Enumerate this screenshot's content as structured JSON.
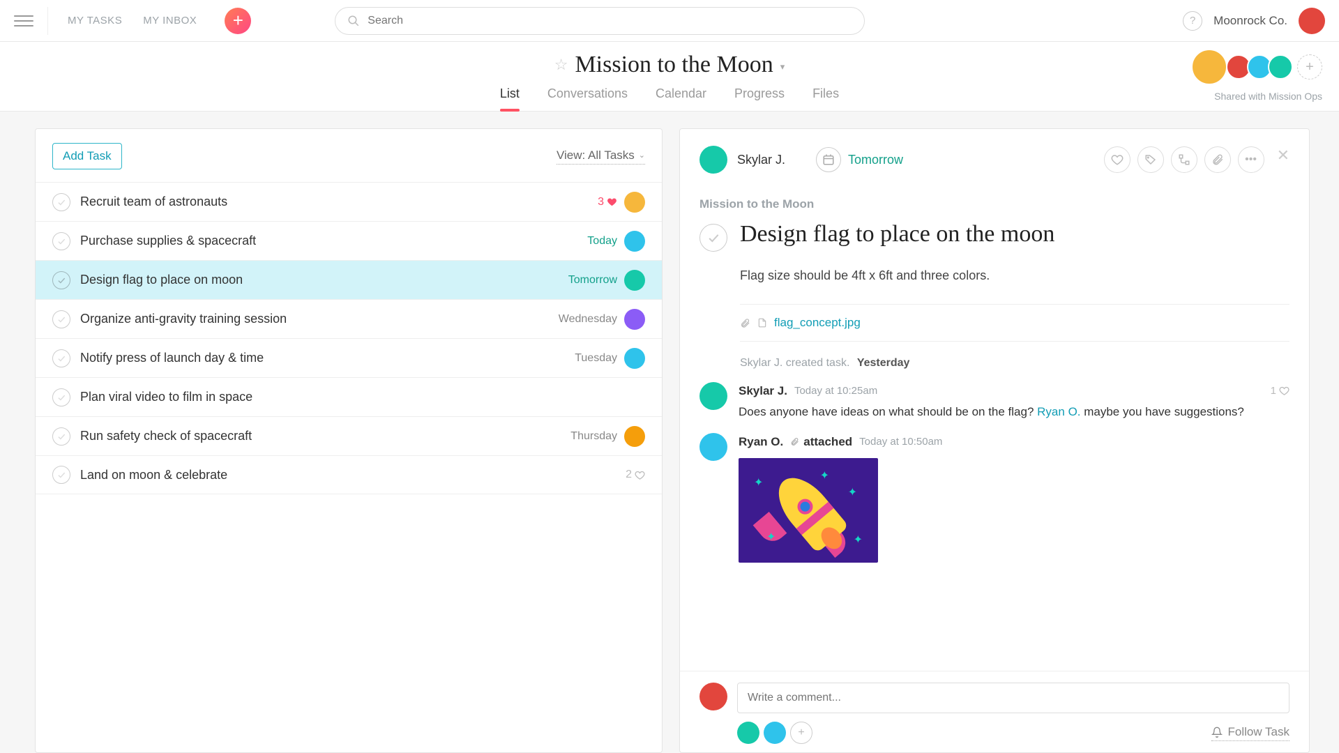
{
  "topbar": {
    "nav": {
      "my_tasks": "MY TASKS",
      "my_inbox": "MY INBOX"
    },
    "search_placeholder": "Search",
    "org": "Moonrock Co."
  },
  "header": {
    "project_name": "Mission to the Moon",
    "tabs": [
      "List",
      "Conversations",
      "Calendar",
      "Progress",
      "Files"
    ],
    "active_tab": 0,
    "shared_with": "Shared with Mission Ops",
    "member_colors": [
      "av-yellow",
      "av-red",
      "av-ltblue",
      "av-teal"
    ]
  },
  "task_list": {
    "add_task_label": "Add Task",
    "view_label": "View: All Tasks",
    "tasks": [
      {
        "title": "Recruit team of astronauts",
        "likes": "3",
        "like_type": "heart-red",
        "avatar": "av-yellow"
      },
      {
        "title": "Purchase supplies & spacecraft",
        "due": "Today",
        "due_class": "due-today",
        "avatar": "av-ltblue"
      },
      {
        "title": "Design flag to place on moon",
        "due": "Tomorrow",
        "due_class": "due-tomorrow",
        "avatar": "av-teal",
        "selected": true
      },
      {
        "title": "Organize anti-gravity training session",
        "due": "Wednesday",
        "due_class": "due-day",
        "avatar": "av-purple"
      },
      {
        "title": "Notify press of launch day & time",
        "due": "Tuesday",
        "due_class": "due-day",
        "avatar": "av-ltblue"
      },
      {
        "title": "Plan viral video to film in space"
      },
      {
        "title": "Run safety check of spacecraft",
        "due": "Thursday",
        "due_class": "due-day",
        "avatar": "av-orange"
      },
      {
        "title": "Land on moon & celebrate",
        "likes": "2",
        "like_type": "heart-gray"
      }
    ]
  },
  "detail": {
    "assignee": {
      "name": "Skylar J.",
      "avatar": "av-teal"
    },
    "due": "Tomorrow",
    "breadcrumb": "Mission to the Moon",
    "title": "Design flag to place on the moon",
    "description": "Flag size should be 4ft x 6ft and three colors.",
    "attachment": "flag_concept.jpg",
    "activity": {
      "text": "Skylar J. created task.",
      "when": "Yesterday"
    },
    "comments": [
      {
        "author": "Skylar J.",
        "avatar": "av-teal",
        "time": "Today at 10:25am",
        "text_pre": "Does anyone have ideas on what should be on the flag? ",
        "mention": "Ryan O.",
        "text_post": " maybe you have suggestions?",
        "likes": "1"
      },
      {
        "author": "Ryan O.",
        "avatar": "av-ltblue",
        "attached_label": "attached",
        "time": "Today at 10:50am",
        "has_image": true
      }
    ],
    "comment_placeholder": "Write a comment...",
    "followers": [
      "av-teal",
      "av-ltblue"
    ],
    "follow_label": "Follow Task"
  }
}
